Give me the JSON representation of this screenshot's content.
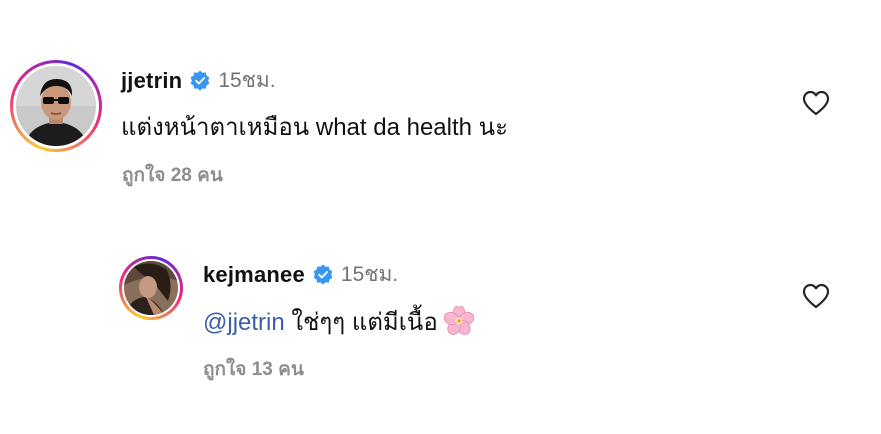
{
  "comments": [
    {
      "username": "jjetrin",
      "time": "15ชม.",
      "text": "แต่งหน้าตาเหมือน what da health นะ",
      "likes": "ถูกใจ 28 คน"
    },
    {
      "username": "kejmanee",
      "time": "15ชม.",
      "mention": "@jjetrin",
      "text": " ใช่ๆๆ แต่มีเนื้อ",
      "likes": "ถูกใจ 13 คน"
    }
  ],
  "icons": {
    "verified": "verified-badge-icon",
    "like": "heart-outline-icon",
    "flower": "cherry-blossom-emoji"
  },
  "colors": {
    "verified": "#3897f0",
    "mention": "#3b5fa6",
    "muted": "#8e8e8e"
  }
}
